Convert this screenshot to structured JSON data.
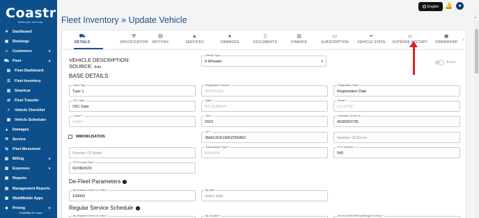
{
  "brand": {
    "name": "Coastr",
    "tagline": "Make your own way."
  },
  "sidebar": {
    "items": [
      {
        "label": "Dashboard",
        "icon": "⌗",
        "sub": false,
        "chevron": ""
      },
      {
        "label": "Bookings",
        "icon": "▣",
        "sub": false,
        "chevron": ""
      },
      {
        "label": "Customers",
        "icon": "☺",
        "sub": false,
        "chevron": "∨"
      },
      {
        "label": "Fleet",
        "icon": "⛟",
        "sub": false,
        "chevron": "∧"
      },
      {
        "label": "Fleet Dashboard",
        "icon": "▤",
        "sub": true,
        "chevron": ""
      },
      {
        "label": "Fleet Inventory",
        "icon": "☰",
        "sub": true,
        "chevron": ""
      },
      {
        "label": "Smartcar",
        "icon": "▥",
        "sub": true,
        "chevron": ""
      },
      {
        "label": "Fleet Transfer",
        "icon": "⇄",
        "sub": true,
        "chevron": ""
      },
      {
        "label": "Vehicle Checklist",
        "icon": "✓",
        "sub": true,
        "chevron": ""
      },
      {
        "label": "Vehicle Scheduler",
        "icon": "▦",
        "sub": true,
        "chevron": ""
      },
      {
        "label": "Damages",
        "icon": "▲",
        "sub": false,
        "chevron": ""
      },
      {
        "label": "Service",
        "icon": "⚒",
        "sub": false,
        "chevron": ""
      },
      {
        "label": "Fleet Movement",
        "icon": "⇆",
        "sub": false,
        "chevron": ""
      },
      {
        "label": "Billing",
        "icon": "▧",
        "sub": false,
        "chevron": "∨"
      },
      {
        "label": "Expenses",
        "icon": "▨",
        "sub": false,
        "chevron": "∨"
      },
      {
        "label": "Reports",
        "icon": "▩",
        "sub": false,
        "chevron": ""
      },
      {
        "label": "Management Reports",
        "icon": "▤",
        "sub": false,
        "chevron": ""
      },
      {
        "label": "Web/Mobile Apps",
        "icon": "▣",
        "sub": false,
        "chevron": ""
      },
      {
        "label": "Pricing",
        "icon": "◈",
        "sub": false,
        "chevron": "∨"
      }
    ],
    "powered": "POWERED BY Coastr"
  },
  "topbar": {
    "language": "English"
  },
  "page_title": "Fleet Inventory » Update Vehicle",
  "tabs": [
    {
      "label": "DETAILS",
      "icon": "⛟",
      "active": true
    },
    {
      "label": "SPECIFICATION",
      "icon": "⚒",
      "active": false
    },
    {
      "label": "MOT/TAX",
      "icon": "▤",
      "active": false
    },
    {
      "label": "SERVICES",
      "icon": "▲",
      "active": false
    },
    {
      "label": "DAMAGES",
      "icon": "●",
      "active": false
    },
    {
      "label": "DOCUMENTS",
      "icon": "▯",
      "active": false
    },
    {
      "label": "FINANCE",
      "icon": "▥",
      "active": false
    },
    {
      "label": "SUBSCRIPTION",
      "icon": "▭",
      "active": false
    },
    {
      "label": "VEHICLE STATE",
      "icon": "━",
      "active": false
    },
    {
      "label": "EXPENSE HISTORY",
      "icon": "▭",
      "active": false
    },
    {
      "label": "OWNERSHIP",
      "icon": "▣",
      "active": false
    }
  ],
  "vehicle": {
    "description_label": "VEHICLE DESCRIPTION:",
    "source_label": "SOURCE:",
    "source_value": "dvla",
    "type_label": "Vehicle Type",
    "type_value": "4 Wheeler",
    "status_label": "Active"
  },
  "sections": {
    "base": "BASE DETAILS",
    "defleet": "De-Fleet Parameters",
    "regular": "Regular Service Schedule"
  },
  "fields": {
    "asset_tag": {
      "label": "Asset Tag *",
      "value": "Type 1"
    },
    "registration_number": {
      "label": "Registration Number *",
      "value": "WM15UZD"
    },
    "registration_date": {
      "label": "Registration Date *",
      "value": "Registration Date"
    },
    "v5c_date": {
      "label": "V5C Date",
      "value": "V5C Date"
    },
    "make": {
      "label": "Make *",
      "value": "MITSUBISHI"
    },
    "model": {
      "label": "Model *",
      "value": "ECLIPSE"
    },
    "colour": {
      "label": "Colour *",
      "value": "GREY"
    },
    "year": {
      "label": "Year *",
      "value": "2019"
    },
    "telematic_device_id": {
      "label": "Telematic Device Id",
      "value": "4638392735"
    },
    "immobilisation": "IMMOBILISATION",
    "vin": {
      "label": "Vin *",
      "value": "JMAXJGK1WKZ000462"
    },
    "number_of_doors": {
      "value": "Number Of Doors"
    },
    "number_of_seats": {
      "value": "Number Of Seats"
    },
    "transmission": {
      "label": "Transmission Type *",
      "value": "MANUAL"
    },
    "pco_number": {
      "label": "PCO Number",
      "value": "545"
    },
    "pco_expiry": {
      "label": "PCO Expiry Date *",
      "value": "02/08/2029"
    },
    "defleet_distance": {
      "label": "By Distance Driven (in mile) *",
      "value": "100000"
    },
    "defleet_date": {
      "label": "By Date",
      "value": "select date"
    },
    "rss_distance": {
      "label": "By Distance Driven (in mile) *"
    },
    "rss_duration": {
      "label": "By Duration *"
    },
    "rss_alert": {
      "label": "Service Alert Before(Mileage in miles) *"
    }
  }
}
